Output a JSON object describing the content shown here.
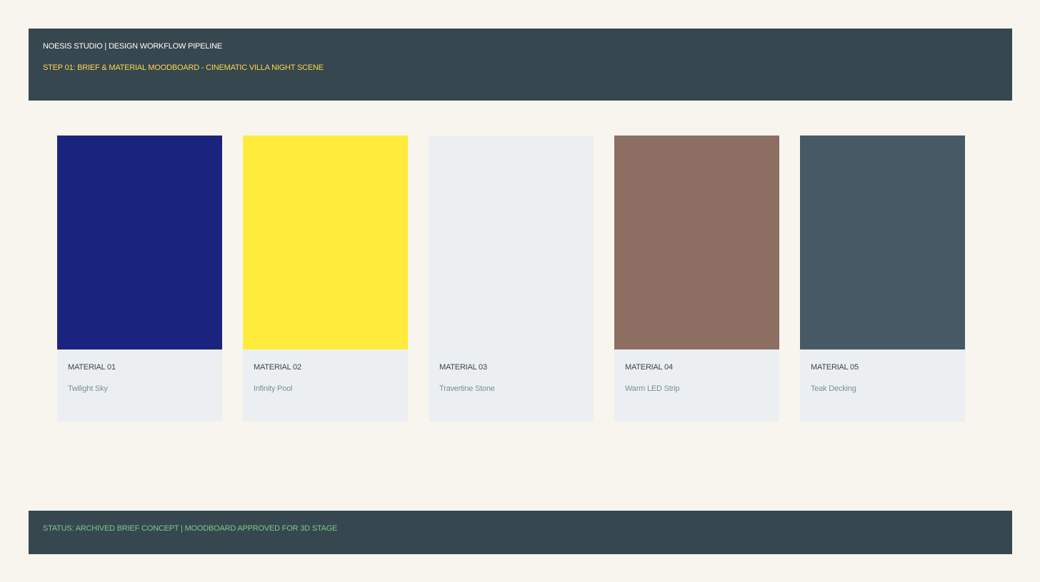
{
  "header": {
    "title": "NOESIS STUDIO | DESIGN WORKFLOW PIPELINE",
    "subtitle": "STEP 01: BRIEF & MATERIAL MOODBOARD - CINEMATIC VILLA NIGHT SCENE"
  },
  "materials": [
    {
      "label": "MATERIAL 01",
      "name": "Twilight Sky",
      "color": "#1a237e"
    },
    {
      "label": "MATERIAL 02",
      "name": "Infinity Pool",
      "color": "#ffeb3b"
    },
    {
      "label": "MATERIAL 03",
      "name": "Travertine Stone",
      "color": "#eceff1"
    },
    {
      "label": "MATERIAL 04",
      "name": "Warm LED Strip",
      "color": "#8d6e63"
    },
    {
      "label": "MATERIAL 05",
      "name": "Teak Decking",
      "color": "#455a64"
    }
  ],
  "footer": {
    "status": "STATUS: ARCHIVED BRIEF CONCEPT | MOODBOARD APPROVED FOR 3D STAGE"
  },
  "colors": {
    "panel": "#37474f",
    "background": "#f8f5ee",
    "card": "#eceff1",
    "subtitle_accent": "#ffd54f",
    "status_accent": "#81c784"
  }
}
